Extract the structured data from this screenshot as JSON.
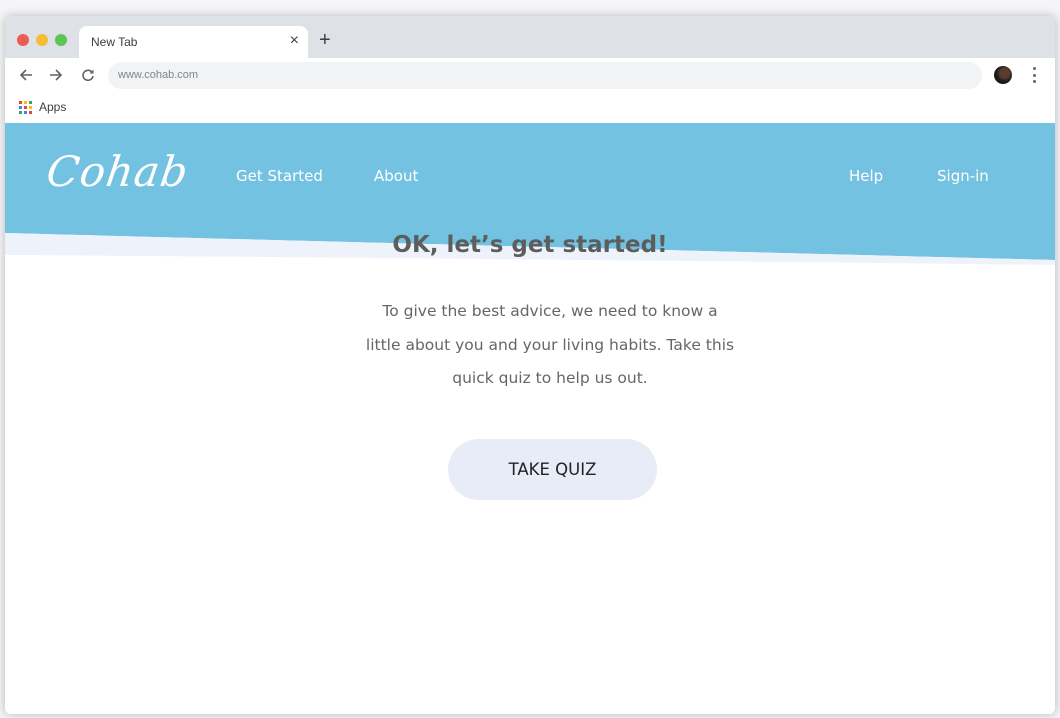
{
  "browser": {
    "tab_title": "New Tab",
    "tab_close": "×",
    "new_tab": "+",
    "url": "www.cohab.com",
    "bookmarks": {
      "apps_label": "Apps"
    },
    "icons": {
      "back": "arrow-left-icon",
      "forward": "arrow-right-icon",
      "reload": "reload-icon",
      "avatar": "profile-avatar",
      "menu": "kebab-menu-icon",
      "apps": "apps-grid-icon"
    },
    "apps_grid_colors": [
      "#ea4335",
      "#fbbc05",
      "#34a853",
      "#4285f4",
      "#ea4335",
      "#fbbc05",
      "#34a853",
      "#4285f4",
      "#ea4335"
    ]
  },
  "site": {
    "logo": "Cohab",
    "nav_left": [
      {
        "label": "Get Started"
      },
      {
        "label": "About"
      }
    ],
    "nav_right": [
      {
        "label": "Help"
      },
      {
        "label": "Sign-in"
      }
    ],
    "colors": {
      "header_blue": "#73c2e1",
      "wave_light": "#eef3fb",
      "button_bg": "#e8ecf6",
      "headline": "#5d5d5d",
      "body_text": "#666666"
    }
  },
  "main": {
    "headline": "OK, let’s get started!",
    "body_lines": [
      "To give the best advice, we need to know a",
      "little about you and your living habits. Take this",
      "quick quiz to help us out."
    ],
    "cta_label": "TAKE QUIZ"
  }
}
